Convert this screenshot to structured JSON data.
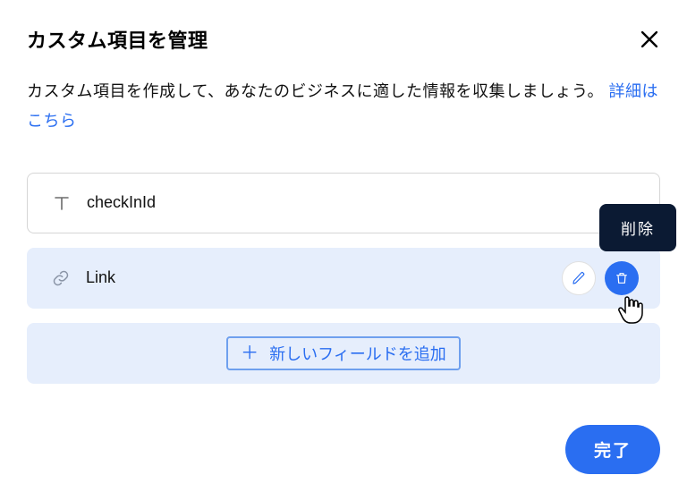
{
  "dialog": {
    "title": "カスタム項目を管理",
    "description_prefix": "カスタム項目を作成して、あなたのビジネスに適した情報を収集しましょう。 ",
    "learn_more": "詳細はこちら"
  },
  "fields": [
    {
      "label": "checkInId",
      "type": "text"
    },
    {
      "label": "Link",
      "type": "link"
    }
  ],
  "add_field_label": "新しいフィールドを追加",
  "tooltip": {
    "delete": "削除"
  },
  "buttons": {
    "done": "完了"
  }
}
